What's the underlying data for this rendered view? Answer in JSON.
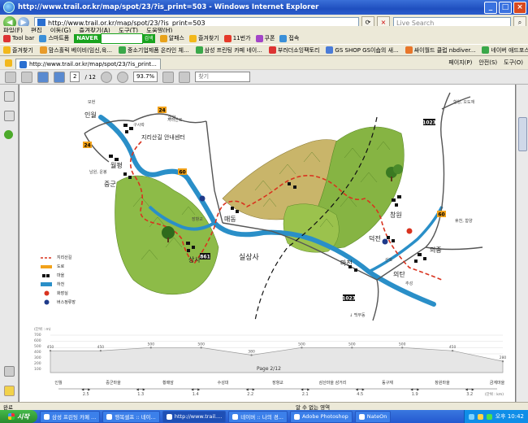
{
  "window": {
    "title": "http://www.trail.or.kr/map/spot/23/?is_print=503 - Windows Internet Explorer",
    "controls": [
      "_",
      "□",
      "×"
    ]
  },
  "address": {
    "url": "http://www.trail.or.kr/map/spot/23/?is_print=503",
    "search_placeholder": "Live Search"
  },
  "menu": {
    "items": [
      "파일(F)",
      "편집",
      "이동(G)",
      "즐겨찾기(A)",
      "도구(T)",
      "도움말(H)"
    ]
  },
  "toolbar": {
    "brand": "Tool bar",
    "items": [
      "스마트폼",
      "NAVER",
      "검색",
      "알패스",
      "즐겨찾기",
      "11번가",
      "쿠폰",
      "접속"
    ]
  },
  "favorites": {
    "label": "즐겨찾기",
    "items": [
      "맘스홀릭 베이비(임신,육...",
      "중소기업제품 온라인 체...",
      "삼성 프린팅 카페 네이...",
      "부러더소잉팩토리",
      "GS SHOP GS이숍의 새...",
      "싸이월드 클럽 nbdiver...",
      "네이버 애드포스트"
    ]
  },
  "tabs": {
    "items": [
      "http://www.trail.or.kr/map/spot/23/?is_print..."
    ],
    "right": [
      "페이지(P)",
      "안전(S)",
      "도구(O)"
    ]
  },
  "pdf": {
    "page": "2",
    "total": "/ 12",
    "zoom": "93.7%",
    "find_placeholder": "찾기"
  },
  "map": {
    "labels": {
      "inwol": "인월",
      "center": "지리산길 안내센터",
      "wolpyeong": "월평",
      "jungjun": "중군",
      "jangHang": "장항교",
      "maedong": "매동",
      "sangsa": "상사",
      "silsangsa": "실상사",
      "mache": "마천",
      "changwon": "창원",
      "deokjeon": "덕전",
      "uijung": "의중",
      "uitan": "의탄",
      "sanho": "산호",
      "chuseong": "추성",
      "mohyeon": "모현",
      "gusi": "구시락",
      "jiriroad": "지리산로",
      "baekmu": "↓ 백무동",
      "hamyang": "함양, 오도재",
      "namwon": "남원, 운봉",
      "hamyang2": "휴천, 함양",
      "sinchon": "함양"
    },
    "road_numbers": [
      "24",
      "24",
      "60",
      "60",
      "861",
      "1023",
      "1023"
    ]
  },
  "legend": {
    "items": [
      "지리산길",
      "도로",
      "마을",
      "하천",
      "화장실",
      "버스정류장"
    ]
  },
  "elevation": {
    "yaxis_unit": "(단위 : m)",
    "yticks": [
      "700",
      "600",
      "500",
      "400",
      "300",
      "200",
      "100"
    ],
    "points": [
      {
        "label": "450",
        "x": 0,
        "y": 450
      },
      {
        "label": "450",
        "x": 1,
        "y": 450
      },
      {
        "label": "500",
        "x": 2,
        "y": 500
      },
      {
        "label": "500",
        "x": 3,
        "y": 500
      },
      {
        "label": "380",
        "x": 4,
        "y": 380
      },
      {
        "label": "500",
        "x": 5,
        "y": 500
      },
      {
        "label": "500",
        "x": 6,
        "y": 500
      },
      {
        "label": "500",
        "x": 7,
        "y": 500
      },
      {
        "label": "450",
        "x": 8,
        "y": 450
      },
      {
        "label": "280",
        "x": 9,
        "y": 280
      }
    ],
    "page_indicator": "Page 2/12",
    "stops": [
      "인월",
      "중군마을",
      "황매암",
      "수성대",
      "장항교",
      "삼산마을 삼거리",
      "동구재",
      "창원마을",
      "금계마을"
    ],
    "segments": [
      "2.5",
      "1.3",
      "1.4",
      "2.2",
      "2.1",
      "4.5",
      "1.9",
      "3.2"
    ],
    "xaxis_unit": "(단위 : km)"
  },
  "status": {
    "left": "완료",
    "center": "알 수 없는 영역"
  },
  "taskbar": {
    "start": "시작",
    "items": [
      "삼성 프린팅 카페 ...",
      "행복셀프 :: 네이...",
      "http://www.trail....",
      "네이버 :: 나의 경...",
      "Adobe Photoshop",
      "NateOn"
    ],
    "clock": "오후 10:42"
  },
  "colors": {
    "trail": "#d9331f",
    "river": "#2a8fc8",
    "mountain": "#7fb23a",
    "titlebar": "#1f4fbf"
  }
}
